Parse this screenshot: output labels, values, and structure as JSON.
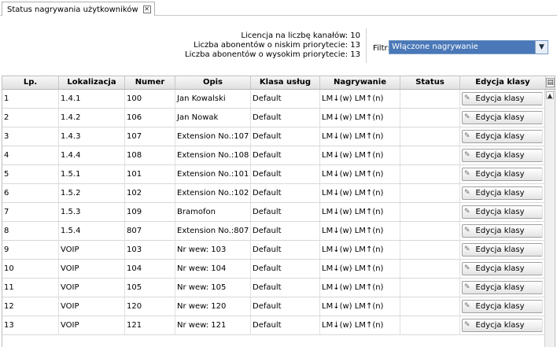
{
  "tab": {
    "label": "Status nagrywania użytkowników",
    "close": "✕"
  },
  "info": {
    "license": "Licencja na liczbę kanałów: 10",
    "low_priority": "Liczba abonentów o niskim priorytecie: 13",
    "high_priority": "Liczba abonentów o wysokim priorytecie: 13"
  },
  "filter": {
    "label": "Filtr:",
    "value": "Włączone nagrywanie"
  },
  "columns": {
    "lp": "Lp.",
    "lokalizacja": "Lokalizacja",
    "numer": "Numer",
    "opis": "Opis",
    "klasa": "Klasa usług",
    "nagrywanie": "Nagrywanie",
    "status": "Status",
    "edycja": "Edycja klasy"
  },
  "rows": [
    {
      "lp": "1",
      "lokalizacja": "1.4.1",
      "numer": "100",
      "opis": "Jan Kowalski",
      "klasa": "Default",
      "nagrywanie": "LM↓(w) LM↑(n)",
      "status": "",
      "edycja": "Edycja klasy"
    },
    {
      "lp": "2",
      "lokalizacja": "1.4.2",
      "numer": "106",
      "opis": "Jan Nowak",
      "klasa": "Default",
      "nagrywanie": "LM↓(w) LM↑(n)",
      "status": "",
      "edycja": "Edycja klasy"
    },
    {
      "lp": "3",
      "lokalizacja": "1.4.3",
      "numer": "107",
      "opis": "Extension No.:107",
      "klasa": "Default",
      "nagrywanie": "LM↓(w) LM↑(n)",
      "status": "",
      "edycja": "Edycja klasy"
    },
    {
      "lp": "4",
      "lokalizacja": "1.4.4",
      "numer": "108",
      "opis": "Extension No.:108",
      "klasa": "Default",
      "nagrywanie": "LM↓(w) LM↑(n)",
      "status": "",
      "edycja": "Edycja klasy"
    },
    {
      "lp": "5",
      "lokalizacja": "1.5.1",
      "numer": "101",
      "opis": "Extension No.:101",
      "klasa": "Default",
      "nagrywanie": "LM↓(w) LM↑(n)",
      "status": "",
      "edycja": "Edycja klasy"
    },
    {
      "lp": "6",
      "lokalizacja": "1.5.2",
      "numer": "102",
      "opis": "Extension No.:102",
      "klasa": "Default",
      "nagrywanie": "LM↓(w) LM↑(n)",
      "status": "",
      "edycja": "Edycja klasy"
    },
    {
      "lp": "7",
      "lokalizacja": "1.5.3",
      "numer": "109",
      "opis": "Bramofon",
      "klasa": "Default",
      "nagrywanie": "LM↓(w) LM↑(n)",
      "status": "",
      "edycja": "Edycja klasy"
    },
    {
      "lp": "8",
      "lokalizacja": "1.5.4",
      "numer": "807",
      "opis": "Extension No.:807",
      "klasa": "Default",
      "nagrywanie": "LM↓(w) LM↑(n)",
      "status": "",
      "edycja": "Edycja klasy"
    },
    {
      "lp": "9",
      "lokalizacja": "VOIP",
      "numer": "103",
      "opis": "Nr wew: 103",
      "klasa": "Default",
      "nagrywanie": "LM↓(w) LM↑(n)",
      "status": "",
      "edycja": "Edycja klasy"
    },
    {
      "lp": "10",
      "lokalizacja": "VOIP",
      "numer": "104",
      "opis": "Nr wew: 104",
      "klasa": "Default",
      "nagrywanie": "LM↓(w) LM↑(n)",
      "status": "",
      "edycja": "Edycja klasy"
    },
    {
      "lp": "11",
      "lokalizacja": "VOIP",
      "numer": "105",
      "opis": "Nr wew: 105",
      "klasa": "Default",
      "nagrywanie": "LM↓(w) LM↑(n)",
      "status": "",
      "edycja": "Edycja klasy"
    },
    {
      "lp": "12",
      "lokalizacja": "VOIP",
      "numer": "120",
      "opis": "Nr wew: 120",
      "klasa": "Default",
      "nagrywanie": "LM↓(w) LM↑(n)",
      "status": "",
      "edycja": "Edycja klasy"
    },
    {
      "lp": "13",
      "lokalizacja": "VOIP",
      "numer": "121",
      "opis": "Nr wew: 121",
      "klasa": "Default",
      "nagrywanie": "LM↓(w) LM↑(n)",
      "status": "",
      "edycja": "Edycja klasy"
    }
  ],
  "icons": {
    "edit": "pencil-icon",
    "dropdown": "chevron-down-icon",
    "column_menu": "column-menu-icon",
    "scroll_up": "scroll-up-icon"
  },
  "colors": {
    "select_bg": "#4a78b8",
    "header_bg": "#e8e8e8"
  }
}
